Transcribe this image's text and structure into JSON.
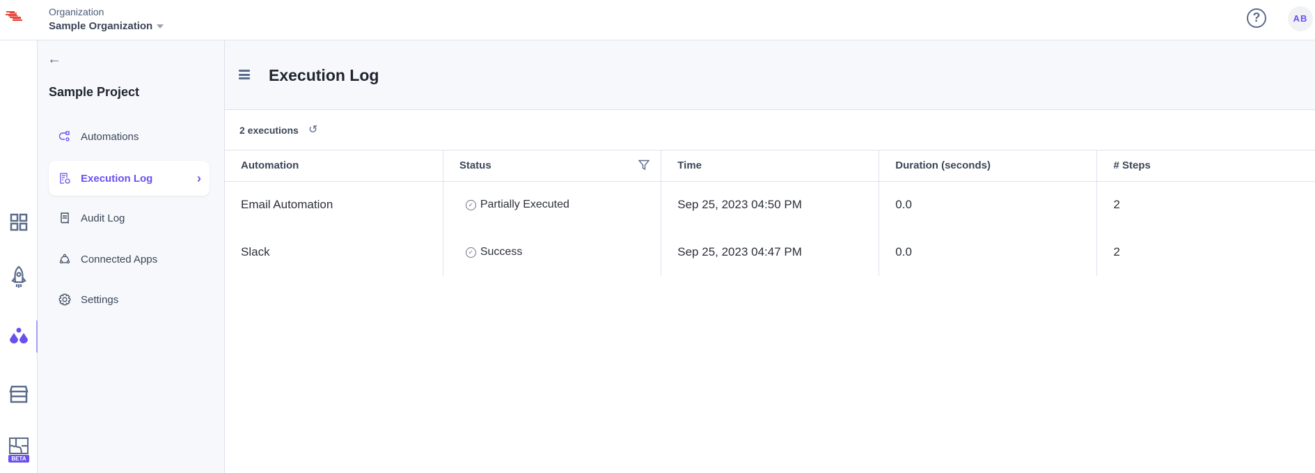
{
  "header": {
    "org_label": "Organization",
    "org_name": "Sample Organization",
    "avatar_initials": "AB",
    "help_icon": "?"
  },
  "rail": {
    "items": [
      "dashboard",
      "deploy",
      "automations",
      "marketplace",
      "integrations"
    ],
    "beta_badge": "BETA",
    "brand_color": "#6a4ff0",
    "logo_color": "#e8473c"
  },
  "sidebar": {
    "back": "←",
    "project": "Sample Project",
    "items": [
      {
        "label": "Automations"
      },
      {
        "label": "Execution Log",
        "active": true
      },
      {
        "label": "Audit Log"
      },
      {
        "label": "Connected Apps"
      },
      {
        "label": "Settings"
      }
    ]
  },
  "main": {
    "title": "Execution Log",
    "count": "2 executions",
    "columns": [
      "Automation",
      "Status",
      "Time",
      "Duration (seconds)",
      "# Steps"
    ],
    "rows": [
      {
        "automation": "Email Automation",
        "status": "Partially Executed",
        "time": "Sep 25, 2023 04:50 PM",
        "duration": "0.0",
        "steps": "2"
      },
      {
        "automation": "Slack",
        "status": "Success",
        "time": "Sep 25, 2023 04:47 PM",
        "duration": "0.0",
        "steps": "2"
      }
    ]
  }
}
